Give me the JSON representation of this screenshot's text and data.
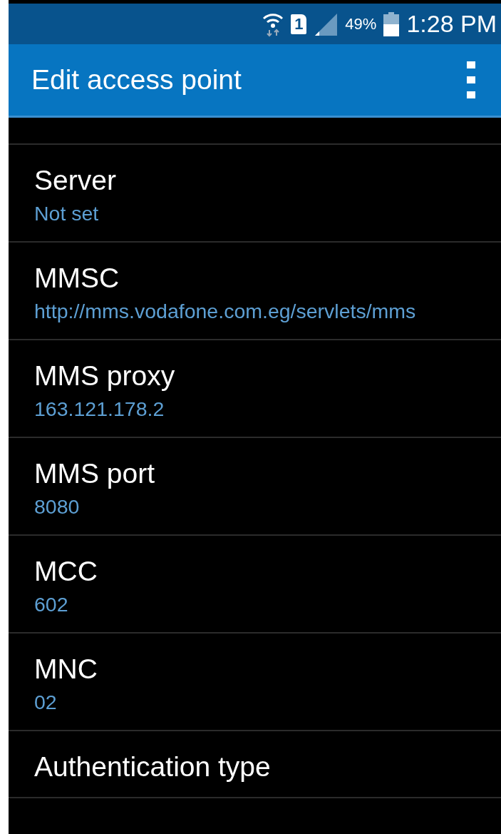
{
  "status_bar": {
    "sim_slot": "1",
    "battery_text": "49%",
    "time": "1:28 PM"
  },
  "app_bar": {
    "title": "Edit access point"
  },
  "settings": [
    {
      "title": "Server",
      "value": "Not set"
    },
    {
      "title": "MMSC",
      "value": "http://mms.vodafone.com.eg/servlets/mms"
    },
    {
      "title": "MMS proxy",
      "value": "163.121.178.2"
    },
    {
      "title": "MMS port",
      "value": "8080"
    },
    {
      "title": "MCC",
      "value": "602"
    },
    {
      "title": "MNC",
      "value": "02"
    },
    {
      "title": "Authentication type"
    }
  ]
}
